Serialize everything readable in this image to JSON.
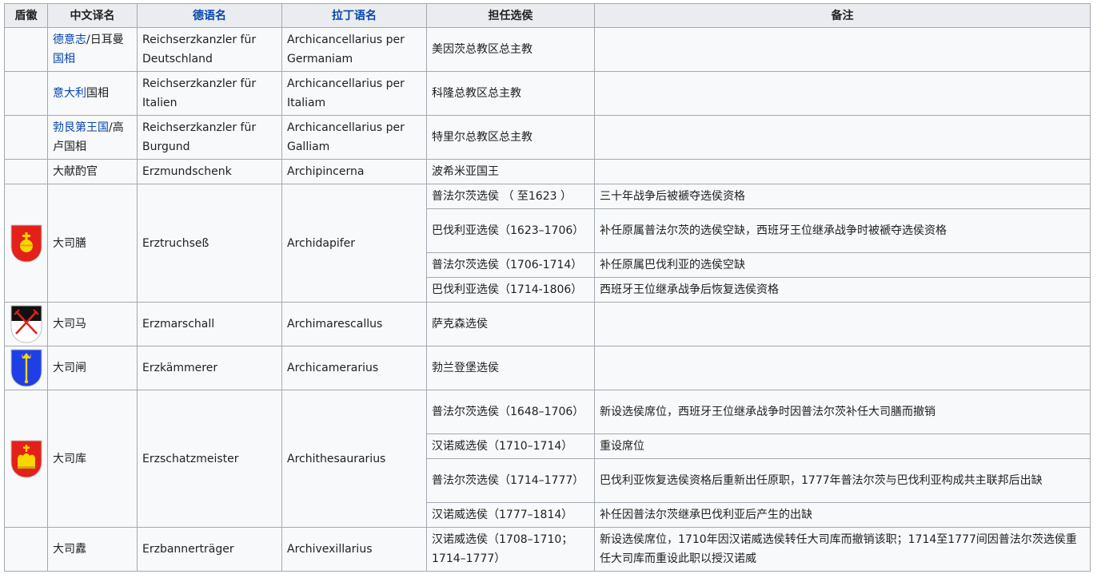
{
  "headers": {
    "coa": "盾徽",
    "zh": "中文译名",
    "de": "德语名",
    "la": "拉丁语名",
    "holder": "担任选侯",
    "notes": "备注"
  },
  "rows": {
    "r0": {
      "zh_link": "德意志",
      "zh_rest": "/日耳曼",
      "zh_link2": "国相",
      "de": "Reichserzkanzler für Deutschland",
      "la": "Archicancellarius per Germaniam",
      "holder": "美因茨总教区总主教",
      "note": ""
    },
    "r1": {
      "zh_link": "意大利",
      "zh_rest": "国相",
      "de": "Reichserzkanzler für Italien",
      "la": "Archicancellarius per Italiam",
      "holder": "科隆总教区总主教",
      "note": ""
    },
    "r2": {
      "zh_link": "勃艮第王国",
      "zh_rest": "/高卢国相",
      "de": "Reichserzkanzler für Burgund",
      "la": "Archicancellarius per Galliam",
      "holder": "特里尔总教区总主教",
      "note": ""
    },
    "r3": {
      "zh": "大献酌官",
      "de": "Erzmundschenk",
      "la": "Archipincerna",
      "holder": "波希米亚国王",
      "note": ""
    },
    "r4": {
      "zh": "大司膳",
      "de": "Erztruchseß",
      "la": "Archidapifer",
      "subs": [
        {
          "holder": "普法尔茨选侯 （ 至1623 ）",
          "note": "三十年战争后被褫夺选侯资格"
        },
        {
          "holder": "巴伐利亚选侯（1623–1706）",
          "note": "补任原属普法尔茨的选侯空缺，西班牙王位继承战争时被褫夺选侯资格"
        },
        {
          "holder": "普法尔茨选侯（1706-1714）",
          "note": "补任原属巴伐利亚的选侯空缺"
        },
        {
          "holder": "巴伐利亚选侯（1714-1806）",
          "note": "西班牙王位继承战争后恢复选侯资格"
        }
      ]
    },
    "r5": {
      "zh": "大司马",
      "de": "Erzmarschall",
      "la": "Archimarescallus",
      "holder": "萨克森选侯",
      "note": ""
    },
    "r6": {
      "zh": "大司闸",
      "de": "Erzkämmerer",
      "la": "Archicamerarius",
      "holder": "勃兰登堡选侯",
      "note": ""
    },
    "r7": {
      "zh": "大司库",
      "de": "Erzschatzmeister",
      "la": "Archithesaurarius",
      "subs": [
        {
          "holder": "普法尔茨选侯（1648–1706）",
          "note": "新设选侯席位，西班牙王位继承战争时因普法尔茨补任大司膳而撤销"
        },
        {
          "holder": "汉诺威选侯（1710–1714）",
          "note": "重设席位"
        },
        {
          "holder": "普法尔茨选侯（1714–1777）",
          "note": "巴伐利亚恢复选侯资格后重新出任原职，1777年普法尔茨与巴伐利亚构成共主联邦后出缺"
        },
        {
          "holder": "汉诺威选侯（1777–1814）",
          "note": "补任因普法尔茨继承巴伐利亚后产生的出缺"
        }
      ]
    },
    "r8": {
      "zh": "大司纛",
      "de": "Erzbannerträger",
      "la": "Archivexillarius",
      "holder": "汉诺威选侯（1708–1710；1714–1777）",
      "note": "新设选侯席位，1710年因汉诺威选侯转任大司库而撤销该职；1714至1777间因普法尔茨选侯重任大司库而重设此职以授汉诺威"
    }
  },
  "colors": {
    "header_bg": "#eaecf0",
    "cell_bg": "#f8f9fa",
    "border": "#a2a9b1",
    "link": "#0645ad",
    "shield_red": "#e4201b",
    "shield_gold": "#fbd500",
    "shield_blue": "#1f3fe6"
  },
  "icons": {
    "r4": "imperial-orb-shield-icon",
    "r5": "crossed-swords-shield-icon",
    "r6": "scepter-shield-icon",
    "r7": "crown-shield-icon"
  }
}
